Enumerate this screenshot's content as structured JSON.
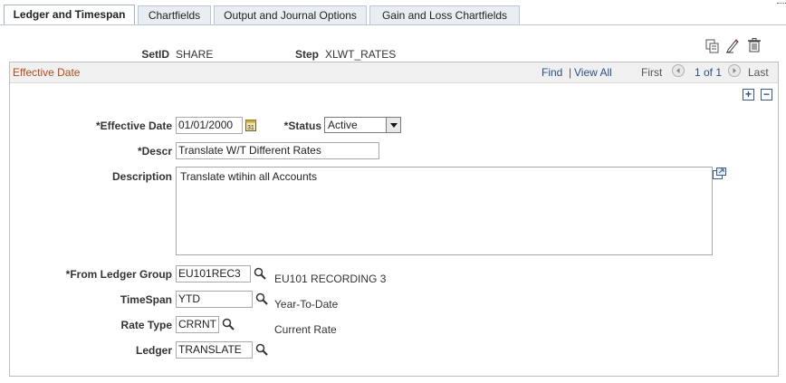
{
  "tabs": [
    {
      "label": "Ledger and Timespan",
      "active": true
    },
    {
      "label": "Chartfields",
      "active": false
    },
    {
      "label": "Output and Journal Options",
      "active": false
    },
    {
      "label": "Gain and Loss Chartfields",
      "active": false
    }
  ],
  "header": {
    "setid_label": "SetID",
    "setid_value": "SHARE",
    "step_label": "Step",
    "step_value": "XLWT_RATES"
  },
  "toolbar_icons": [
    "copy-icon",
    "edit-icon",
    "delete-icon"
  ],
  "effective_date_section": {
    "title": "Effective Date",
    "find": "Find",
    "separator": "|",
    "view_all": "View All",
    "first": "First",
    "page_info": "1 of 1",
    "last": "Last"
  },
  "form": {
    "effective_date_label": "*Effective Date",
    "effective_date_value": "01/01/2000",
    "status_label": "*Status",
    "status_value": "Active",
    "descr_label": "*Descr",
    "descr_value": "Translate W/T Different Rates",
    "description_label": "Description",
    "description_value": "Translate wtihin all Accounts",
    "from_ledger_group_label": "*From Ledger Group",
    "from_ledger_group_value": "EU101REC3",
    "from_ledger_group_desc": "EU101 RECORDING 3",
    "timespan_label": "TimeSpan",
    "timespan_value": "YTD",
    "timespan_desc": "Year-To-Date",
    "rate_type_label": "Rate Type",
    "rate_type_value": "CRRNT",
    "rate_type_desc": "Current Rate",
    "ledger_label": "Ledger",
    "ledger_value": "TRANSLATE"
  },
  "colors": {
    "section_title": "#b24a1a",
    "link": "#2a4f8a",
    "tab_border": "#b8c8d8"
  }
}
